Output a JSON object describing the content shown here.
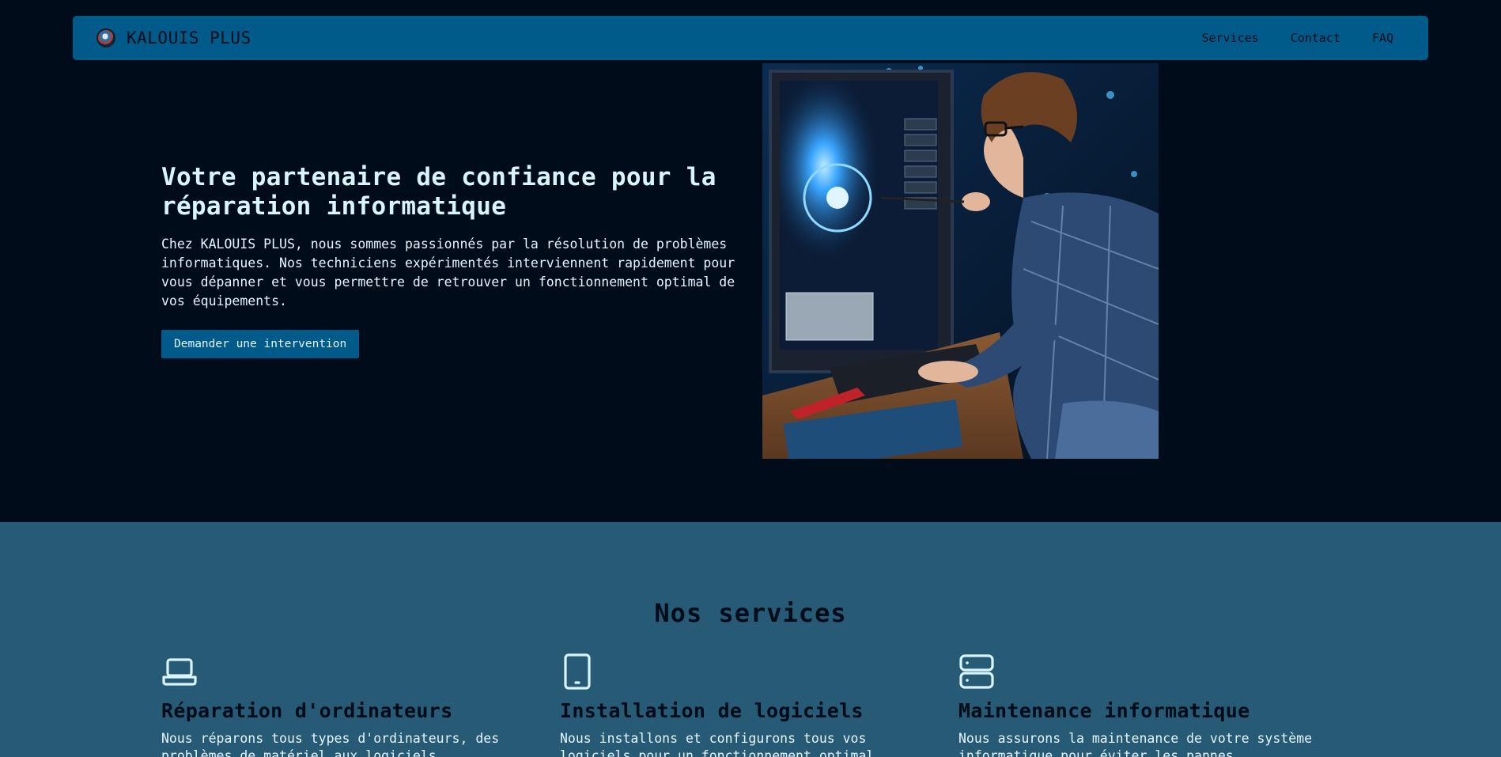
{
  "navbar": {
    "brand": "KALOUIS PLUS",
    "links": [
      "Services",
      "Contact",
      "FAQ"
    ]
  },
  "hero": {
    "title": "Votre partenaire de confiance pour la réparation informatique",
    "description": "Chez KALOUIS PLUS, nous sommes passionnés par la résolution de problèmes informatiques. Nos techniciens expérimentés interviennent rapidement pour vous dépanner et vous permettre de retrouver un fonctionnement optimal de vos équipements.",
    "cta_label": "Demander une intervention"
  },
  "services": {
    "title": "Nos services",
    "items": [
      {
        "icon": "laptop-icon",
        "title": "Réparation d'ordinateurs",
        "description": "Nous réparons tous types d'ordinateurs, des problèmes de matériel aux logiciels."
      },
      {
        "icon": "tablet-icon",
        "title": "Installation de logiciels",
        "description": "Nous installons et configurons tous vos logiciels pour un fonctionnement optimal."
      },
      {
        "icon": "server-icon",
        "title": "Maintenance informatique",
        "description": "Nous assurons la maintenance de votre système informatique pour éviter les pannes."
      }
    ]
  },
  "colors": {
    "background": "#000c1a",
    "primary": "#005a8a",
    "services_bg": "#275a74",
    "text_light": "#e6f6ff"
  }
}
